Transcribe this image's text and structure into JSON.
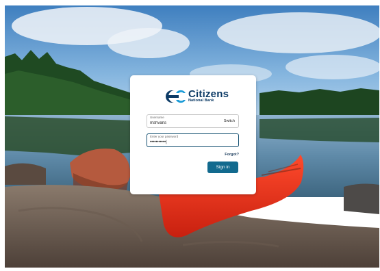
{
  "brand": {
    "name": "Citizens",
    "subtitle": "National Bank",
    "color": "#0d3b66",
    "logo_icon": "citizens-c-icon"
  },
  "form": {
    "username": {
      "label": "Username",
      "value": "mshvans"
    },
    "switch_label": "Switch",
    "password": {
      "label": "Enter your password",
      "value": "•••••••••••|"
    },
    "forgot_label": "Forgot?",
    "signin_label": "Sign in"
  },
  "colors": {
    "button": "#126a8e",
    "password_border": "#0f4c6e"
  }
}
